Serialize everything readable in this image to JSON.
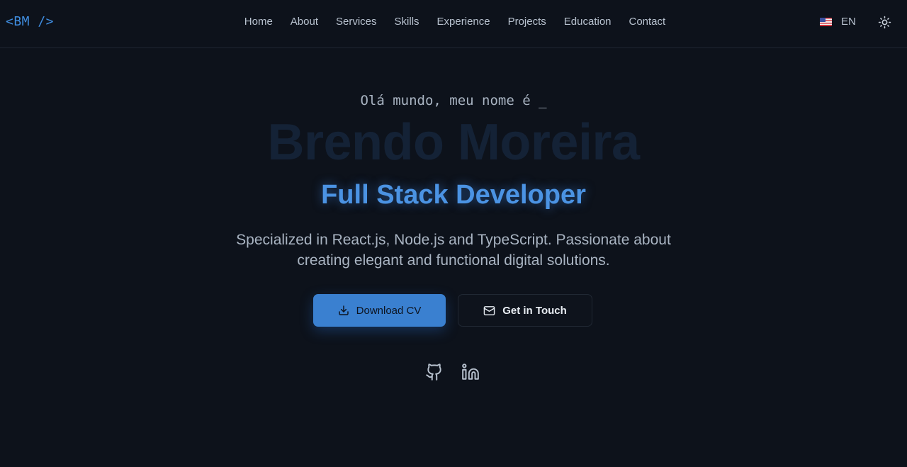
{
  "header": {
    "logo": "<BM />",
    "nav": [
      "Home",
      "About",
      "Services",
      "Skills",
      "Experience",
      "Projects",
      "Education",
      "Contact"
    ],
    "language": "EN"
  },
  "hero": {
    "greeting": "Olá mundo, meu nome é _",
    "name": "Brendo Moreira",
    "role": "Full Stack Developer",
    "description": "Specialized in React.js, Node.js and TypeScript. Passionate about creating elegant and functional digital solutions.",
    "download_cv": "Download CV",
    "get_in_touch": "Get in Touch"
  },
  "icons": {
    "flag": "us-flag-icon",
    "theme": "sun-icon",
    "download": "download-icon",
    "mail": "mail-icon",
    "github": "github-icon",
    "linkedin": "linkedin-icon"
  },
  "colors": {
    "background": "#0d121b",
    "accent": "#3f8de0",
    "name_faded": "#142236"
  }
}
